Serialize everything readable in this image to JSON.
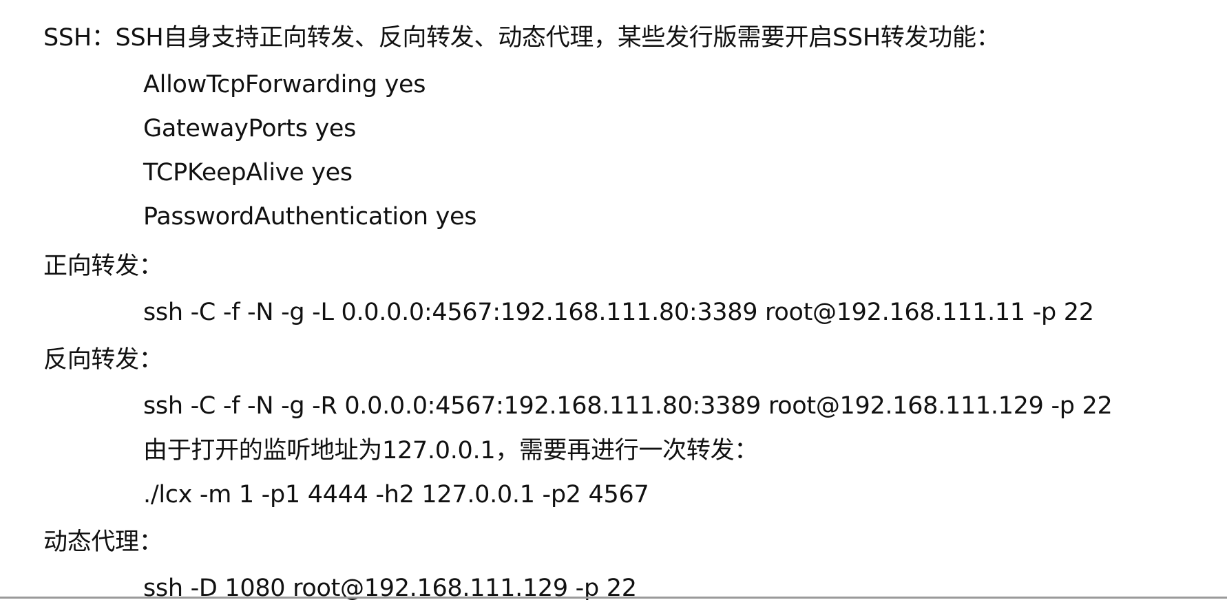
{
  "ssh_section": {
    "heading": "SSH：SSH自身支持正向转发、反向转发、动态代理，某些发行版需要开启SSH转发功能：",
    "config_lines": [
      "AllowTcpForwarding yes",
      "GatewayPorts yes",
      "TCPKeepAlive yes",
      "PasswordAuthentication yes"
    ]
  },
  "forward_section": {
    "heading": "正向转发：",
    "command": "ssh -C -f -N -g -L 0.0.0.0:4567:192.168.111.80:3389 root@192.168.111.11 -p 22"
  },
  "reverse_section": {
    "heading": "反向转发：",
    "command": "ssh -C -f -N -g -R 0.0.0.0:4567:192.168.111.80:3389 root@192.168.111.129 -p 22",
    "note": "由于打开的监听地址为127.0.0.1，需要再进行一次转发：",
    "lcx_command": "./lcx -m 1 -p1 4444  -h2 127.0.0.1 -p2 4567"
  },
  "dynamic_section": {
    "heading": "动态代理：",
    "command": "ssh -D 1080 root@192.168.111.129 -p 22"
  }
}
